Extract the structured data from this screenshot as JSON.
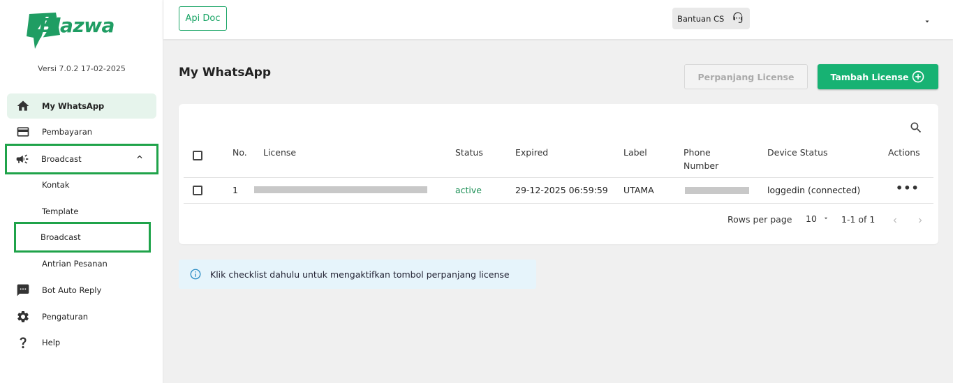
{
  "brand": {
    "name_prefix": "Blaz",
    "name_suffix": "wa",
    "version": "Versi 7.0.2 17-02-2025",
    "color": "#1f9d63"
  },
  "sidebar": {
    "items": [
      {
        "label": "My WhatsApp",
        "icon": "home-icon",
        "active": true
      },
      {
        "label": "Pembayaran",
        "icon": "credit-card-icon"
      },
      {
        "label": "Broadcast",
        "icon": "megaphone-icon",
        "expanded": true
      },
      {
        "label": "Bot Auto Reply",
        "icon": "chat-icon"
      },
      {
        "label": "Pengaturan",
        "icon": "gear-icon"
      },
      {
        "label": "Help",
        "icon": "question-icon"
      }
    ],
    "broadcast_sub": [
      {
        "label": "Kontak"
      },
      {
        "label": "Template"
      },
      {
        "label": "Broadcast"
      },
      {
        "label": "Antrian Pesanan"
      }
    ]
  },
  "topbar": {
    "api_doc": "Api Doc",
    "cs_label": "Bantuan CS"
  },
  "main": {
    "title": "My WhatsApp",
    "btn_perpanjang": "Perpanjang License",
    "btn_tambah": "Tambah License"
  },
  "table": {
    "headers": {
      "no": "No.",
      "license": "License",
      "status": "Status",
      "expired": "Expired",
      "label": "Label",
      "phone_1": "Phone",
      "phone_2": "Number",
      "device_status": "Device Status",
      "actions": "Actions"
    },
    "rows": [
      {
        "no": "1",
        "status": "active",
        "expired": "29-12-2025 06:59:59",
        "label": "UTAMA",
        "device_status": "loggedin (connected)"
      }
    ],
    "pagination": {
      "rows_per_page_label": "Rows per page",
      "rows_per_page": "10",
      "range": "1-1 of 1"
    }
  },
  "info": {
    "text": "Klik checklist dahulu untuk mengaktifkan tombol perpanjang license"
  },
  "colors": {
    "accent": "#17b273",
    "highlight_box": "#1fa34a",
    "status_active": "#1b8f55"
  }
}
